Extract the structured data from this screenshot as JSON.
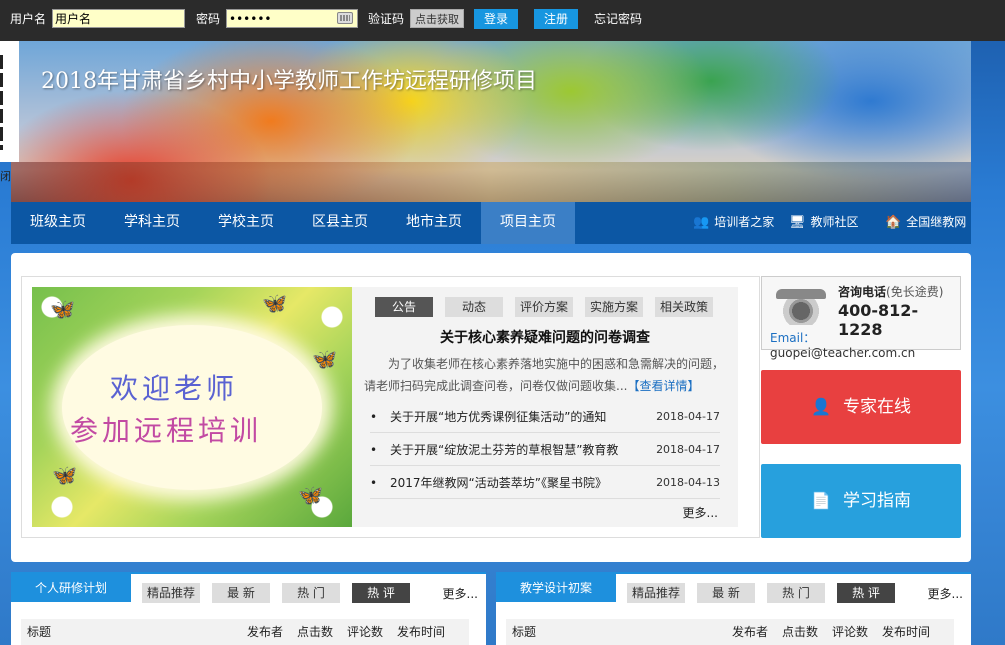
{
  "login": {
    "username_label": "用户名",
    "username_value": "用户名",
    "password_label": "密码",
    "password_value": "••••••",
    "captcha_label": "验证码",
    "get_code_button": "点击获取",
    "login_button": "登录",
    "register_button": "注册",
    "forgot_password": "忘记密码"
  },
  "banner": {
    "title": "2018年甘肃省乡村中小学教师工作坊远程研修项目"
  },
  "side_tab": {
    "label": "闭"
  },
  "nav": {
    "items": [
      {
        "label": "班级主页"
      },
      {
        "label": "学科主页"
      },
      {
        "label": "学校主页"
      },
      {
        "label": "区县主页"
      },
      {
        "label": "地市主页"
      },
      {
        "label": "项目主页"
      }
    ],
    "active_item": "项目主页",
    "links": [
      {
        "label": "培训者之家",
        "icon": "people-icon"
      },
      {
        "label": "教师社区",
        "icon": "monitor-icon"
      },
      {
        "label": "全国继教网",
        "icon": "home-icon"
      }
    ]
  },
  "welcome": {
    "line1": "欢迎老师",
    "line2": "参加远程培训"
  },
  "news": {
    "tabs": [
      {
        "label": "公告"
      },
      {
        "label": "动态"
      },
      {
        "label": "评价方案"
      },
      {
        "label": "实施方案"
      },
      {
        "label": "相关政策"
      }
    ],
    "active_tab": "公告",
    "headline": "关于核心素养疑难问题的问卷调查",
    "summary": "为了收集老师在核心素养落地实施中的困惑和急需解决的问题，请老师扫码完成此调查问卷，问卷仅做问题收集...",
    "summary_more": "【查看详情】",
    "items": [
      {
        "title": "关于开展“地方优秀课例征集活动”的通知",
        "date": "2018-04-17"
      },
      {
        "title": "关于开展“绽放泥土芬芳的草根智慧”教育教",
        "date": "2018-04-17"
      },
      {
        "title": "2017年继教网“活动荟萃坊”《聚星书院》",
        "date": "2018-04-13"
      }
    ],
    "more": "更多..."
  },
  "hotline": {
    "title": "咨询电话",
    "subtitle": "(免长途费)",
    "number": "400-812-1228",
    "email_label": "Email：",
    "email": "guopei@teacher.com.cn"
  },
  "buttons": {
    "expert": "专家在线",
    "guide": "学习指南"
  },
  "panels": [
    {
      "title": "个人研修计划",
      "tabs": [
        {
          "label": "精品推荐"
        },
        {
          "label": "最 新"
        },
        {
          "label": "热 门"
        },
        {
          "label": "热 评"
        }
      ],
      "active_tab": "热 评",
      "more": "更多...",
      "columns": [
        "标题",
        "发布者",
        "点击数",
        "评论数",
        "发布时间"
      ]
    },
    {
      "title": "教学设计初案",
      "tabs": [
        {
          "label": "精品推荐"
        },
        {
          "label": "最 新"
        },
        {
          "label": "热 门"
        },
        {
          "label": "热 评"
        }
      ],
      "active_tab": "热 评",
      "more": "更多...",
      "columns": [
        "标题",
        "发布者",
        "点击数",
        "评论数",
        "发布时间"
      ]
    }
  ],
  "colors": {
    "topbar": "#2b2b2b",
    "nav": "#0c57a4",
    "accent_blue": "#1e90dd",
    "expert_red": "#e84040",
    "guide_blue": "#27a0dd"
  }
}
